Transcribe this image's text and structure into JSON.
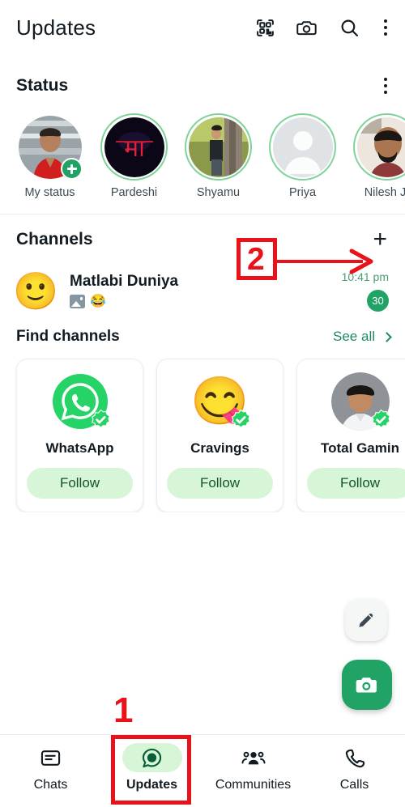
{
  "header": {
    "title": "Updates",
    "icons": [
      {
        "name": "qr-scan-icon"
      },
      {
        "name": "camera-icon"
      },
      {
        "name": "search-icon"
      },
      {
        "name": "overflow-menu-icon"
      }
    ]
  },
  "status": {
    "title": "Status",
    "menu_icon": "overflow-menu-icon",
    "items": [
      {
        "label": "My status",
        "ring": "none",
        "has_plus": true
      },
      {
        "label": "Pardeshi",
        "ring": "unseen",
        "has_plus": false
      },
      {
        "label": "Shyamu",
        "ring": "unseen",
        "has_plus": false
      },
      {
        "label": "Priya",
        "ring": "unseen",
        "has_plus": false
      },
      {
        "label": "Nilesh J.",
        "ring": "unseen",
        "has_plus": false
      }
    ]
  },
  "channels": {
    "title": "Channels",
    "add_icon": "plus-icon",
    "list": [
      {
        "name": "Matlabi Duniya",
        "avatar_emoji": "🙂",
        "subtitle_photo_icon": "photo-icon",
        "subtitle_emoji": "😂",
        "time": "10:41 pm",
        "unread": "30"
      }
    ]
  },
  "find_channels": {
    "title": "Find channels",
    "see_all_label": "See all",
    "chevron_icon": "chevron-right-icon",
    "cards": [
      {
        "name": "WhatsApp",
        "follow_label": "Follow",
        "verified": true,
        "avatar_type": "whatsapp-logo"
      },
      {
        "name": "Cravings",
        "follow_label": "Follow",
        "verified": true,
        "avatar_type": "emoji",
        "avatar_emoji": "😋"
      },
      {
        "name": "Total Gamin",
        "follow_label": "Follow",
        "verified": true,
        "avatar_type": "photo"
      }
    ]
  },
  "fabs": [
    {
      "name": "compose-pencil-fab",
      "icon": "pencil-icon"
    },
    {
      "name": "camera-fab",
      "icon": "camera-icon"
    }
  ],
  "bottom_nav": {
    "items": [
      {
        "label": "Chats",
        "icon": "chats-icon",
        "active": false
      },
      {
        "label": "Updates",
        "icon": "updates-icon",
        "active": true
      },
      {
        "label": "Communities",
        "icon": "communities-icon",
        "active": false
      },
      {
        "label": "Calls",
        "icon": "calls-icon",
        "active": false
      }
    ]
  },
  "annotations": {
    "color": "#e8121b",
    "step1": {
      "label": "1",
      "target": "Updates tab"
    },
    "step2": {
      "label": "2",
      "target": "Channels add (+) button"
    }
  }
}
